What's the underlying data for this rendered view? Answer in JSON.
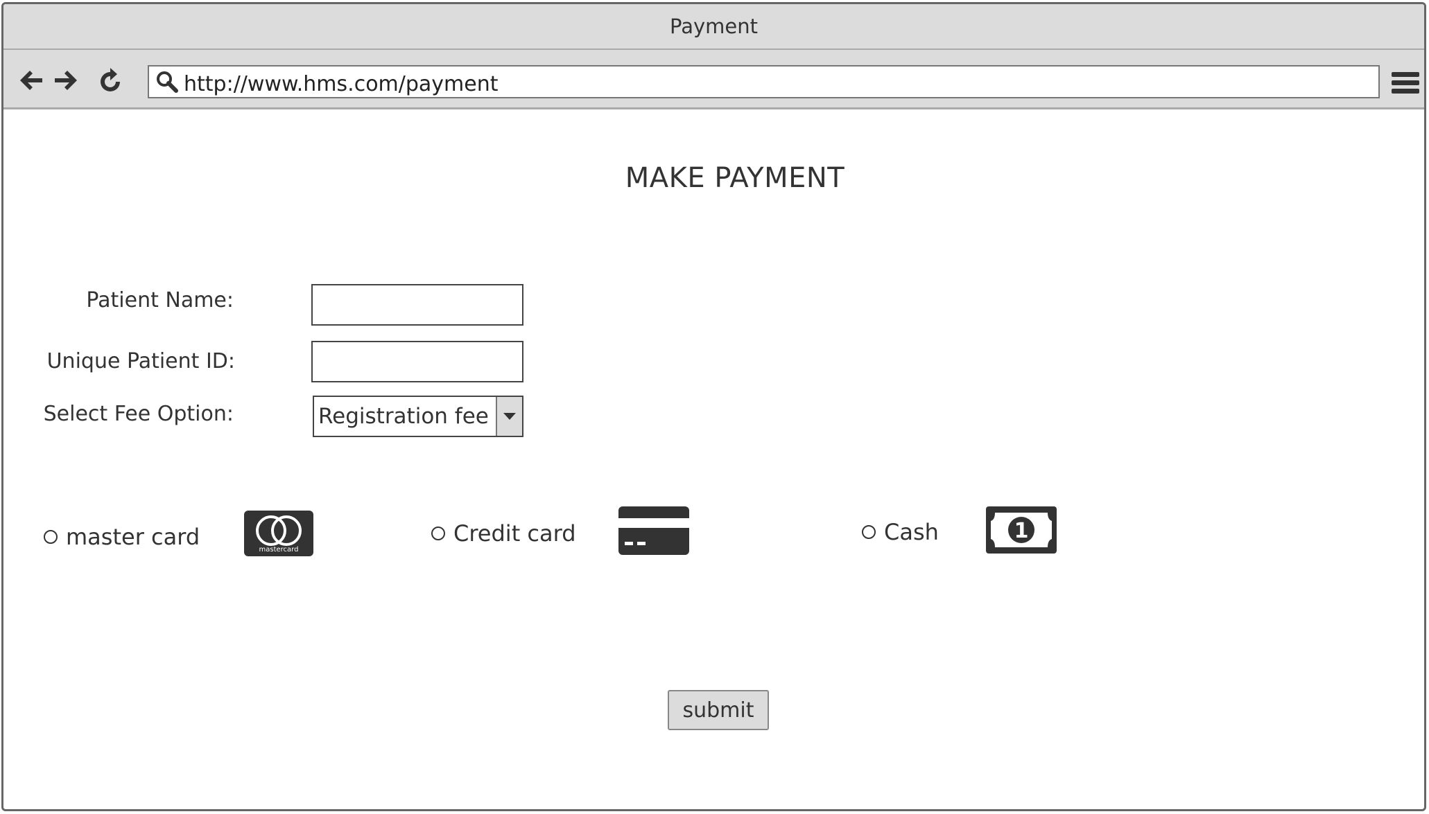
{
  "window": {
    "title": "Payment"
  },
  "browser": {
    "url": "http://www.hms.com/payment",
    "back_icon": "arrow-left-icon",
    "forward_icon": "arrow-right-icon",
    "reload_icon": "reload-icon",
    "menu_icon": "hamburger-menu-icon",
    "search_icon": "search-icon"
  },
  "page": {
    "title": "MAKE PAYMENT"
  },
  "form": {
    "patient_name_label": "Patient Name:",
    "patient_name_value": "",
    "patient_id_label": "Unique Patient ID:",
    "patient_id_value": "",
    "fee_option_label": "Select Fee Option:",
    "fee_option_selected": "Registration fee"
  },
  "payment_methods": [
    {
      "label": "master card",
      "icon": "mastercard-icon",
      "icon_text": "mastercard"
    },
    {
      "label": "Credit card",
      "icon": "credit-card-icon"
    },
    {
      "label": "Cash",
      "icon": "cash-icon",
      "icon_text": "1"
    }
  ],
  "actions": {
    "submit_label": "submit"
  },
  "colors": {
    "chrome_bg": "#dcdcdc",
    "border": "#666666",
    "icon": "#333333",
    "text": "#333333"
  }
}
